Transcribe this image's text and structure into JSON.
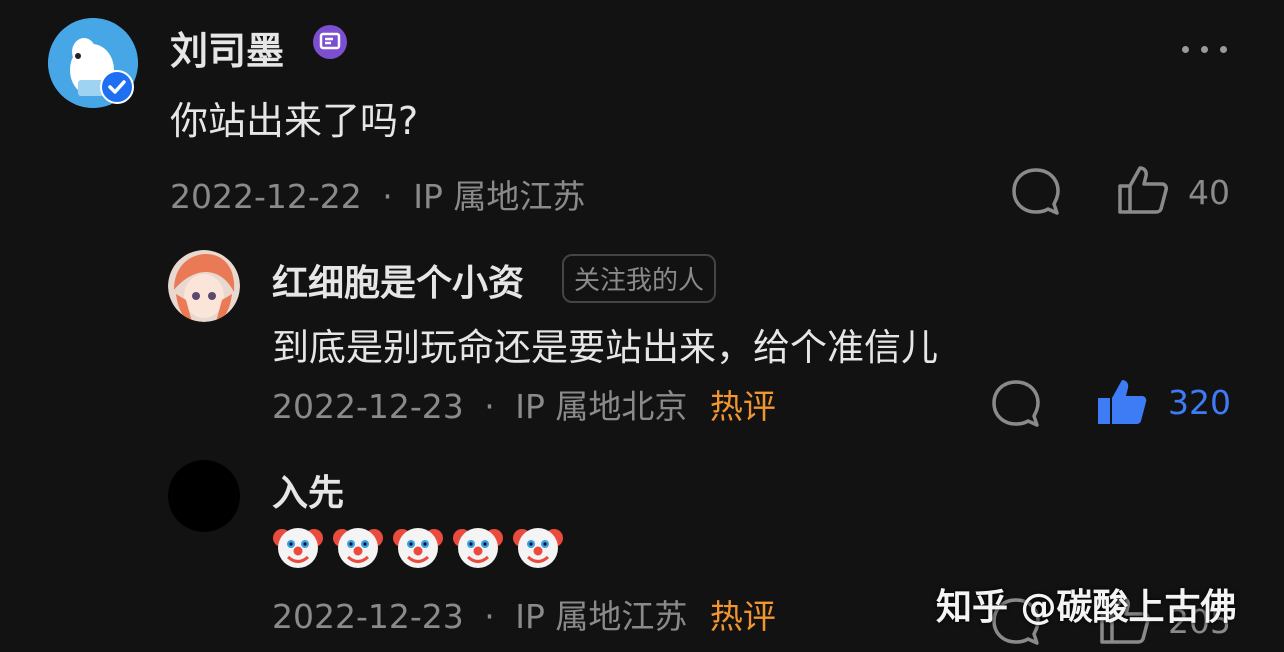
{
  "comments": [
    {
      "author": "刘司墨",
      "text": "你站出来了吗?",
      "date": "2022-12-22",
      "sep": "·",
      "location": "IP 属地江苏",
      "like_count": "40"
    },
    {
      "author": "红细胞是个小资",
      "tag": "关注我的人",
      "text": "到底是别玩命还是要站出来，给个准信儿",
      "date": "2022-12-23",
      "sep": "·",
      "location": "IP 属地北京",
      "hot": "热评",
      "like_count": "320"
    },
    {
      "author": "入先",
      "emoji_count": 5,
      "date": "2022-12-23",
      "sep": "·",
      "location": "IP 属地江苏",
      "hot": "热评",
      "like_count": "205"
    }
  ],
  "watermark": "知乎 @碳酸上古佛",
  "colors": {
    "background": "#121212",
    "hot": "#f0952f",
    "liked": "#3d7cf5",
    "badge": "#7b4fd0"
  }
}
